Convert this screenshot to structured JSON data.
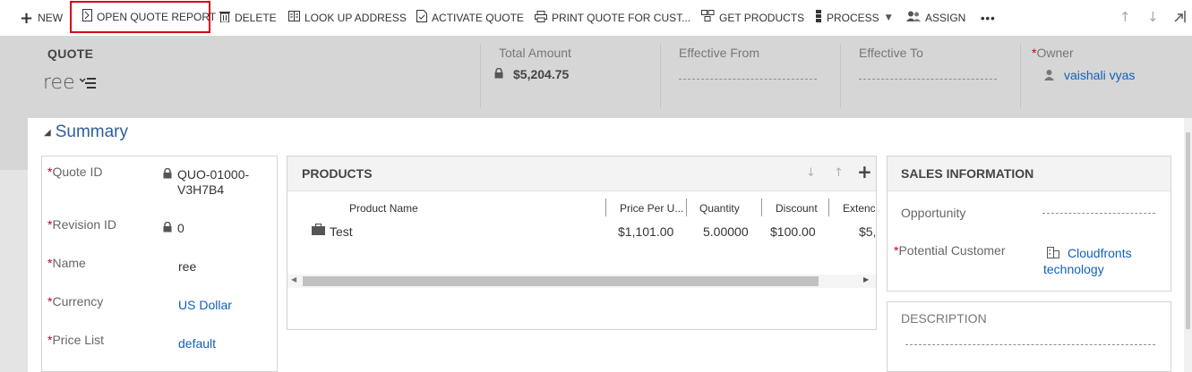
{
  "commands": {
    "new": "NEW",
    "open_quote_report": "OPEN QUOTE REPORT",
    "delete": "DELETE",
    "look_up_address": "LOOK UP ADDRESS",
    "activate_quote": "ACTIVATE QUOTE",
    "print_quote": "PRINT QUOTE FOR CUST...",
    "get_products": "GET PRODUCTS",
    "process": "PROCESS",
    "assign": "ASSIGN",
    "more": "•••"
  },
  "header": {
    "entity_type": "QUOTE",
    "record_name": "ree",
    "total_amount_label": "Total Amount",
    "total_amount_value": "$5,204.75",
    "effective_from_label": "Effective From",
    "effective_to_label": "Effective To",
    "owner_label": "Owner",
    "owner_value": "vaishali vyas"
  },
  "summary": {
    "title": "Summary",
    "fields": {
      "quote_id_label": "Quote ID",
      "quote_id_value_line1": "QUO-01000-",
      "quote_id_value_line2": "V3H7B4",
      "revision_id_label": "Revision ID",
      "revision_id_value": "0",
      "name_label": "Name",
      "name_value": "ree",
      "currency_label": "Currency",
      "currency_value": "US Dollar",
      "price_list_label": "Price List",
      "price_list_value": "default"
    }
  },
  "products": {
    "title": "PRODUCTS",
    "columns": [
      "Product Name",
      "Price Per U...",
      "Quantity",
      "Discount",
      "Extenc"
    ],
    "rows": [
      {
        "product_name": "Test",
        "price_per_unit": "$1,101.00",
        "quantity": "5.00000",
        "discount": "$100.00",
        "extended": "$5,"
      }
    ]
  },
  "sales_information": {
    "title": "SALES INFORMATION",
    "opportunity_label": "Opportunity",
    "potential_customer_label": "Potential Customer",
    "potential_customer_line1": "Cloudfronts",
    "potential_customer_line2": "technology"
  },
  "description": {
    "title": "DESCRIPTION"
  },
  "colors": {
    "accent_link": "#1160b7",
    "required": "#c4001c",
    "highlight_border": "#d9001b",
    "header_bg": "#d6d6d6"
  }
}
